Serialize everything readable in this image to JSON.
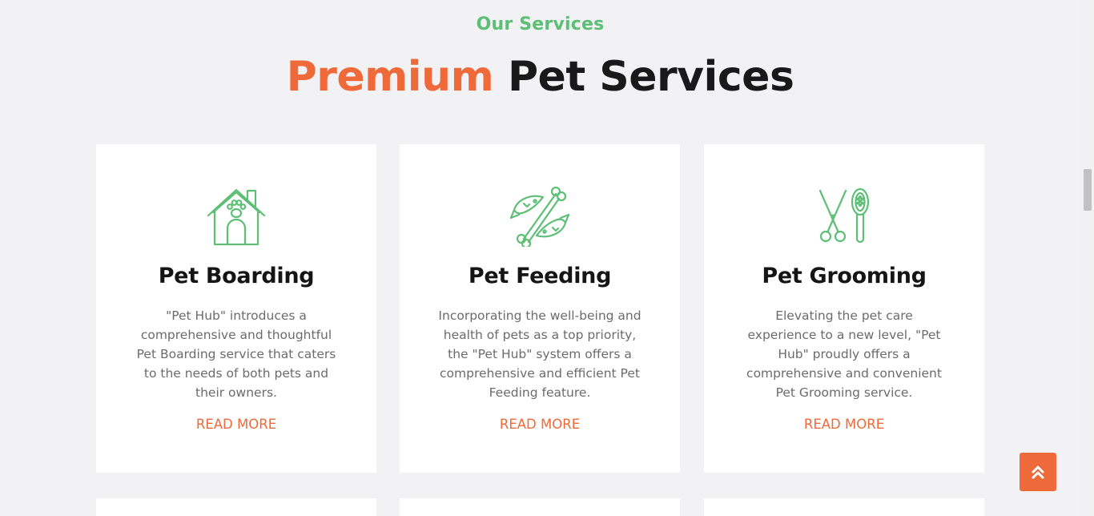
{
  "section": {
    "eyebrow": "Our Services",
    "title_accent": "Premium",
    "title_rest": "Pet Services"
  },
  "colors": {
    "accent": "#ee6a3a",
    "green": "#5cbf75",
    "background": "#f2f2f4",
    "card": "#ffffff"
  },
  "cards": [
    {
      "icon": "house-paw-icon",
      "title": "Pet Boarding",
      "description": "\"Pet Hub\" introduces a comprehensive and thoughtful Pet Boarding service that caters to the needs of both pets and their owners.",
      "link": "READ MORE"
    },
    {
      "icon": "fish-bone-icon",
      "title": "Pet Feeding",
      "description": "Incorporating the well-being and health of pets as a top priority, the \"Pet Hub\" system offers a comprehensive and efficient Pet Feeding feature.",
      "link": "READ MORE"
    },
    {
      "icon": "scissors-brush-icon",
      "title": "Pet Grooming",
      "description": "Elevating the pet care experience to a new level, \"Pet Hub\" proudly offers a comprehensive and convenient Pet Grooming service.",
      "link": "READ MORE"
    }
  ],
  "back_to_top": {
    "icon": "double-chevron-up-icon"
  }
}
